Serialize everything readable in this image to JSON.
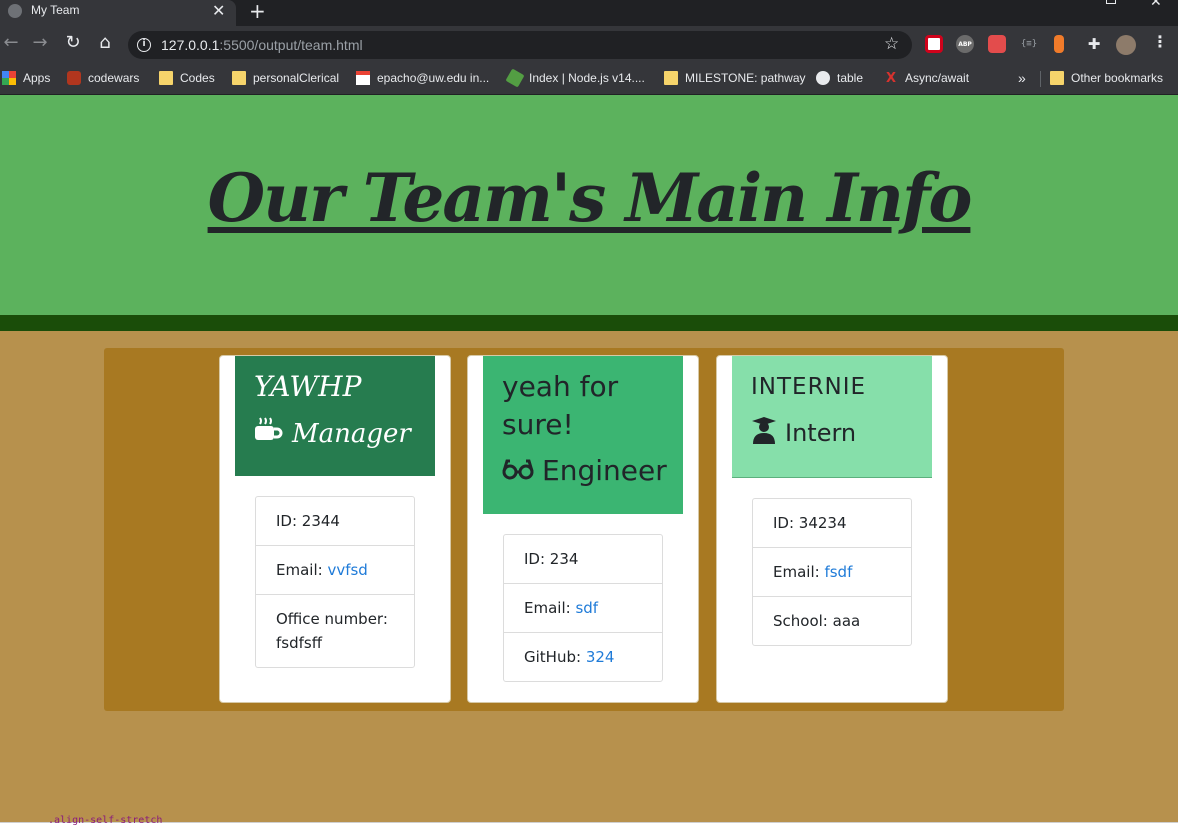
{
  "browser": {
    "tab_title": "My Team",
    "tab_close": "✕",
    "new_tab": "+",
    "url_host": "127.0.0.1",
    "url_rest": ":5500/output/team.html",
    "window_close": "✕"
  },
  "bookmarks": [
    {
      "label": "Apps",
      "icon": "apps-grid-icon"
    },
    {
      "label": "codewars",
      "icon": "codewars-icon"
    },
    {
      "label": "Codes",
      "icon": "folder-icon"
    },
    {
      "label": "personalClerical",
      "icon": "folder-icon"
    },
    {
      "label": "epacho@uw.edu in...",
      "icon": "gmail-icon"
    },
    {
      "label": "Index | Node.js v14....",
      "icon": "nodejs-icon"
    },
    {
      "label": "MILESTONE: pathway",
      "icon": "folder-icon"
    },
    {
      "label": "table",
      "icon": "github-icon"
    },
    {
      "label": "Async/await",
      "icon": "async-icon"
    }
  ],
  "bookmarks_more": "»",
  "other_bookmarks": "Other bookmarks",
  "page": {
    "title": "Our Team's Main Info"
  },
  "team": [
    {
      "name": "YAWHP",
      "role": "Manager",
      "role_icon": "coffee-mug-icon",
      "head_color": "#267c4f",
      "head_text_color": "#ffffff",
      "items": [
        {
          "label": "ID: ",
          "value": "2344"
        },
        {
          "label": "Email: ",
          "value": "vvfsd",
          "link": true
        },
        {
          "label": "Office number: ",
          "value": "fsdfsff"
        }
      ]
    },
    {
      "name": "yeah for sure!",
      "role": "Engineer",
      "role_icon": "glasses-icon",
      "head_color": "#3bb572",
      "head_text_color": "#212529",
      "items": [
        {
          "label": "ID: ",
          "value": "234"
        },
        {
          "label": "Email: ",
          "value": "sdf",
          "link": true
        },
        {
          "label": "GitHub: ",
          "value": "324",
          "link": true
        }
      ]
    },
    {
      "name": "INTERNIE",
      "role": "Intern",
      "role_icon": "graduate-icon",
      "head_color": "#86dfaa",
      "head_text_color": "#212529",
      "items": [
        {
          "label": "ID: ",
          "value": "34234"
        },
        {
          "label": "Email: ",
          "value": "fsdf",
          "link": true
        },
        {
          "label": "School: ",
          "value": "aaa"
        }
      ]
    }
  ],
  "devtools_hint": ".align-self-stretch"
}
